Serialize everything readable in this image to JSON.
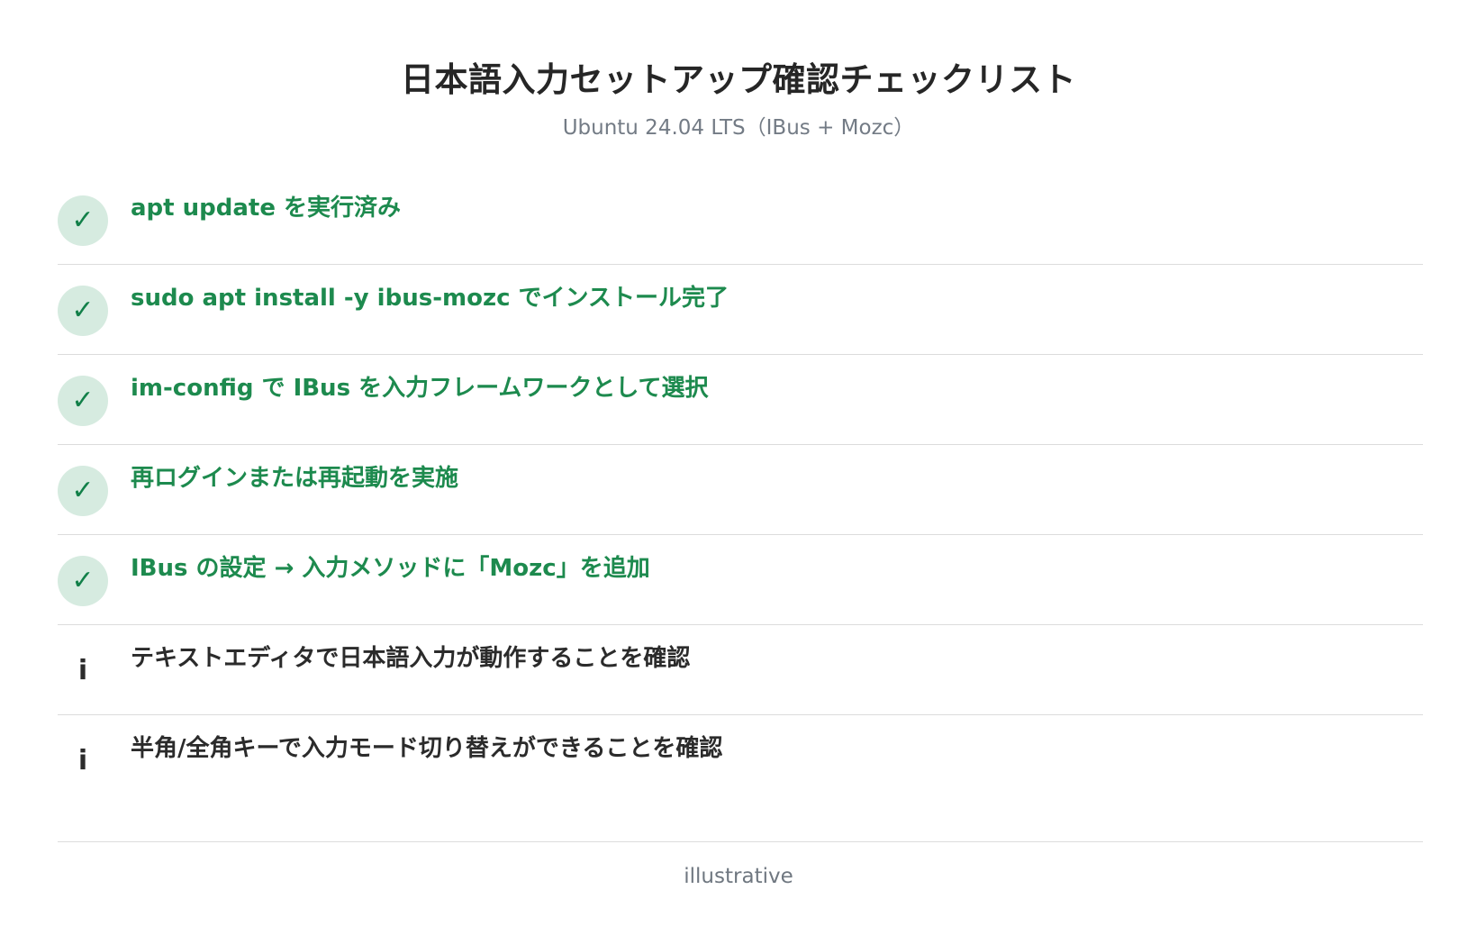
{
  "header": {
    "title": "日本語入力セットアップ確認チェックリスト",
    "subtitle": "Ubuntu 24.04 LTS（IBus + Mozc）"
  },
  "colors": {
    "done_text": "#1d8a4e",
    "done_badge_bg": "#d6ebe0",
    "done_mark": "#128049",
    "info_text": "#2b2b2b",
    "divider": "#dcdcdc"
  },
  "items": [
    {
      "status": "done",
      "icon": "checkmark-icon",
      "mark": "✓",
      "text": "apt update を実行済み"
    },
    {
      "status": "done",
      "icon": "checkmark-icon",
      "mark": "✓",
      "text": "sudo apt install -y ibus-mozc でインストール完了"
    },
    {
      "status": "done",
      "icon": "checkmark-icon",
      "mark": "✓",
      "text": "im-config で IBus を入力フレームワークとして選択"
    },
    {
      "status": "done",
      "icon": "checkmark-icon",
      "mark": "✓",
      "text": "再ログインまたは再起動を実施"
    },
    {
      "status": "done",
      "icon": "checkmark-icon",
      "mark": "✓",
      "text": "IBus の設定 → 入力メソッドに「Mozc」を追加"
    },
    {
      "status": "info",
      "icon": "info-icon",
      "mark": "i",
      "text": "テキストエディタで日本語入力が動作することを確認"
    },
    {
      "status": "info",
      "icon": "info-icon",
      "mark": "i",
      "text": "半角/全角キーで入力モード切り替えができることを確認"
    }
  ],
  "footer": {
    "note": "illustrative"
  }
}
